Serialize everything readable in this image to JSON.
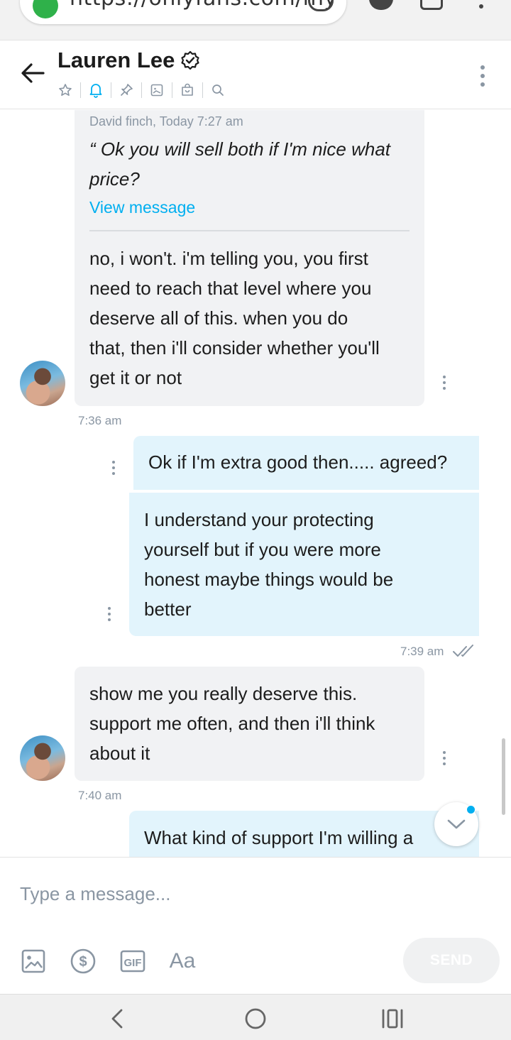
{
  "browser": {
    "url": "https://onlyfans.com/my"
  },
  "header": {
    "contact_name": "Lauren Lee",
    "icons": [
      "back-arrow-icon",
      "verified-badge-icon",
      "star-icon",
      "bell-icon",
      "pin-icon",
      "image-icon",
      "bag-icon",
      "search-icon",
      "more-vertical-icon"
    ],
    "accent_color": "#00aff0"
  },
  "messages": [
    {
      "direction": "incoming",
      "quote": {
        "meta": "David finch, Today 7:27 am",
        "text_line1": "“ Ok you will sell both if I'm nice what",
        "text_line2": "price?",
        "link": "View message"
      },
      "lines": [
        "no, i won't. i'm telling you, you first",
        "need to reach that level where you",
        "deserve all of this. when you do",
        "that, then i'll consider whether you'll",
        "get it or not"
      ],
      "time": "7:36 am"
    },
    {
      "direction": "outgoing",
      "lines": [
        "Ok if I'm extra good then..... agreed?"
      ]
    },
    {
      "direction": "outgoing",
      "lines": [
        "I understand your protecting",
        "yourself but if you were more",
        "honest maybe things would be",
        "better"
      ],
      "time": "7:39 am"
    },
    {
      "direction": "incoming",
      "lines": [
        "show me you really deserve this.",
        "support me often, and then i'll think",
        "about it"
      ],
      "time": "7:40 am"
    },
    {
      "direction": "outgoing",
      "lines": [
        "What kind of support I'm willing a"
      ]
    }
  ],
  "composer": {
    "placeholder": "Type a message...",
    "tools": [
      "image-icon",
      "dollar-icon",
      "gif-icon",
      "text-format-icon"
    ],
    "text_format_label": "Aa",
    "gif_label": "GIF",
    "send_label": "SEND"
  },
  "colors": {
    "incoming_bubble": "#f1f2f4",
    "outgoing_bubble": "#e2f4fc",
    "muted_text": "#8a96a3"
  }
}
